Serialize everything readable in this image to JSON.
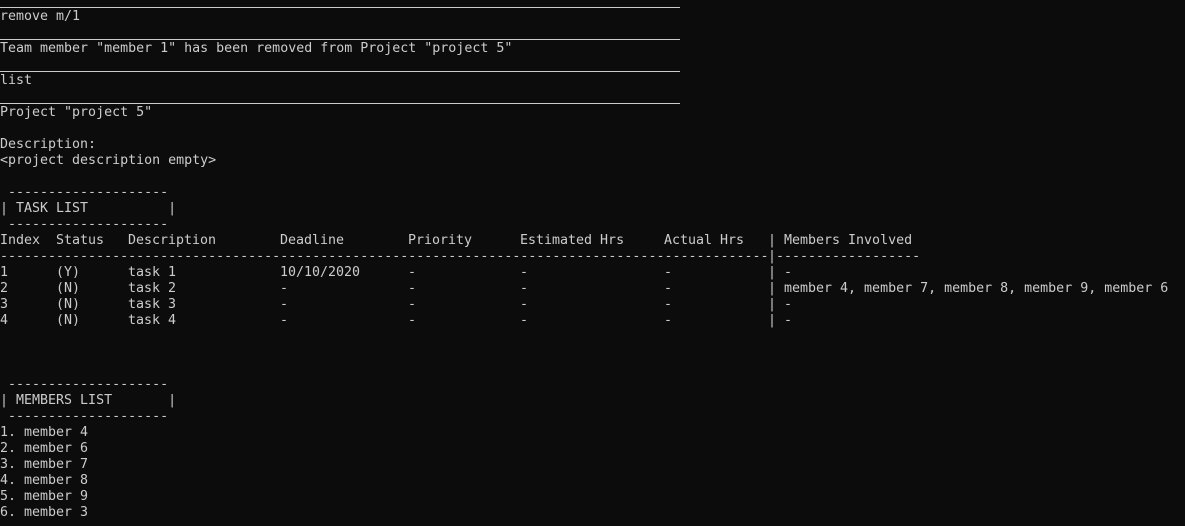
{
  "terminal": {
    "colors": {
      "background": "#0c0c0c",
      "foreground": "#cccccc"
    },
    "echo_command_1": "remove m/1",
    "output_1": "Team member \"member 1\" has been removed from Project \"project 5\"",
    "echo_command_2": "list",
    "project_title": "Project \"project 5\"",
    "description_label": "Description:",
    "description_value": "<project description empty>",
    "task_box": {
      "top": " --------------------",
      "title": "| TASK LIST          |",
      "bottom": " --------------------"
    },
    "task_table": {
      "headers": [
        "Index",
        "Status",
        "Description",
        "Deadline",
        "Priority",
        "Estimated Hrs",
        "Actual Hrs",
        "Members Involved"
      ],
      "header_separator": "|",
      "divider_left": "------------------------------------------------------------------------------------------------",
      "divider_mid": "|",
      "divider_right": "------------------",
      "rows": [
        {
          "index": "1",
          "status": "(Y)",
          "description": "task 1",
          "deadline": "10/10/2020",
          "priority": "-",
          "estimated": "-",
          "actual": "-",
          "sep": "|",
          "members": "-"
        },
        {
          "index": "2",
          "status": "(N)",
          "description": "task 2",
          "deadline": "-",
          "priority": "-",
          "estimated": "-",
          "actual": "-",
          "sep": "|",
          "members": "member 4, member 7, member 8, member 9, member 6"
        },
        {
          "index": "3",
          "status": "(N)",
          "description": "task 3",
          "deadline": "-",
          "priority": "-",
          "estimated": "-",
          "actual": "-",
          "sep": "|",
          "members": "-"
        },
        {
          "index": "4",
          "status": "(N)",
          "description": "task 4",
          "deadline": "-",
          "priority": "-",
          "estimated": "-",
          "actual": "-",
          "sep": "|",
          "members": "-"
        }
      ]
    },
    "members_box": {
      "top": " --------------------",
      "title": "| MEMBERS LIST       |",
      "bottom": " --------------------"
    },
    "members_list": [
      "1. member 4",
      "2. member 6",
      "3. member 7",
      "4. member 8",
      "5. member 9",
      "6. member 3"
    ]
  }
}
